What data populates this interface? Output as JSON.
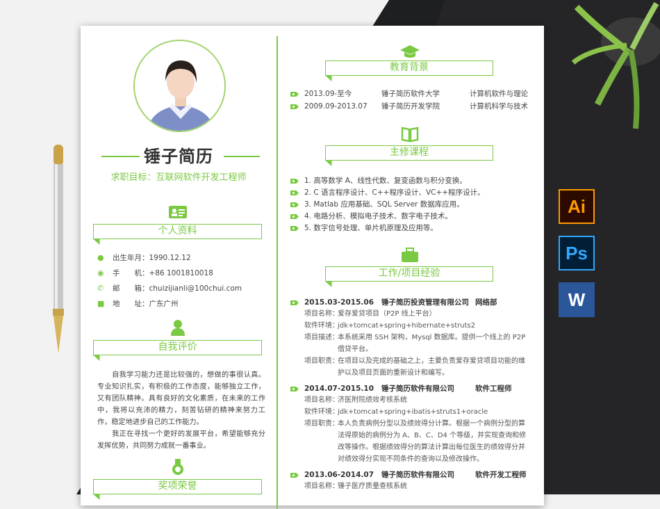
{
  "colors": {
    "accent": "#7ac943",
    "text": "#333333",
    "bg_dark": "#1e1f21"
  },
  "resume": {
    "name": "锤子简历",
    "target": "求职目标：互联网软件开发工程师",
    "sections": {
      "personal": "个人资料",
      "eval": "自我评价",
      "awards": "奖项荣誉",
      "education": "教育背景",
      "courses": "主修课程",
      "work": "工作/项目经验"
    },
    "personal": [
      {
        "icon": "person-icon",
        "label": "出生年月：",
        "value": "1990.12.12"
      },
      {
        "icon": "location-icon",
        "label": "手　　机：",
        "value": "+86 1001810018"
      },
      {
        "icon": "phone-icon",
        "label": "邮　　箱：",
        "value": "chuizijianli@100chui.com"
      },
      {
        "icon": "mail-icon",
        "label": "地　　址：",
        "value": "广东广州"
      }
    ],
    "eval_p1": "　　自我学习能力还是比较强的，想做的事很认真。专业知识扎实，有积极的工作态度，能够独立工作，又有团队精神。具有良好的文化素质，在未来的工作中，我将以充沛的精力，刻苦钻研的精神来努力工作，稳定地进步自己的工作能力。",
    "eval_p2": "　　我正在寻找一个更好的发展平台，希望能够充分发挥优势，共同努力成就一番事业。",
    "education": [
      {
        "date": "2013.09-至今",
        "school": "锤子简历软件大学",
        "major": "计算机软件与理论"
      },
      {
        "date": "2009.09-2013.07",
        "school": "锤子简历开发学院",
        "major": "计算机科学与技术"
      }
    ],
    "courses": [
      "1.  高等数学 A、线性代数、复变函数与积分变换。",
      "2.  C 语言程序设计、C++程序设计、VC++程序设计。",
      "3.  Matlab 应用基础、SQL Server 数据库应用。",
      "4.  电路分析、模拟电子技术、数字电子技术。",
      "5.  数字信号处理、单片机原理及应用等。"
    ],
    "jobs": [
      {
        "date": "2015.03-2015.06",
        "company": "锤子简历投资管理有限公司",
        "role": "网络部",
        "d1k": "项目名称：",
        "d1v": "爱存爱贷项目（P2P 线上平台）",
        "d2k": "软件环境：",
        "d2v": "jdk+tomcat+spring+hibernate+struts2",
        "d3k": "项目描述：",
        "d3v1": "本系统采用 SSH 架构，Mysql 数据库。提供一个线上的 P2P",
        "d3v2": "借贷平台。",
        "d4k": "项目职责：",
        "d4v1": "在项目以及完成的基础之上，主要负责爱存爱贷项目功能的维",
        "d4v2": "护以及项目页面的重新设计和编写。"
      },
      {
        "date": "2014.07-2015.10",
        "company": "锤子简历软件有限公司",
        "role": "软件工程师",
        "d1k": "项目名称：",
        "d1v": "济医附院绩效考核系统",
        "d2k": "软件环境：",
        "d2v": "jdk+tomcat+spring+ibatis+struts1+oracle",
        "d4k": "项目职责：",
        "d4v1": "本人负责病例分型以及绩效得分计算。根据一个病例分型的算",
        "d4v2": "法得原始的病例分为 A、B、C、D4 个等级，并实现查询和修",
        "d4v3": "改等操作。根据绩效得分的算法计算出每位医生的绩效得分并",
        "d4v4": "对绩效得分实现不同条件的查询以及修改操作。"
      },
      {
        "date": "2013.06-2014.07",
        "company": "锤子简历软件有限公司",
        "role": "软件开发工程师",
        "d1k": "项目名称：",
        "d1v": "锤子医疗质量查核系统"
      }
    ]
  },
  "apps": [
    {
      "label": "Ai",
      "color": "#ff9a00",
      "bg": "#2d0a00"
    },
    {
      "label": "Ps",
      "color": "#31a8ff",
      "bg": "#001e36"
    },
    {
      "label": "W",
      "color": "#ffffff",
      "bg": "#2b579a"
    }
  ]
}
